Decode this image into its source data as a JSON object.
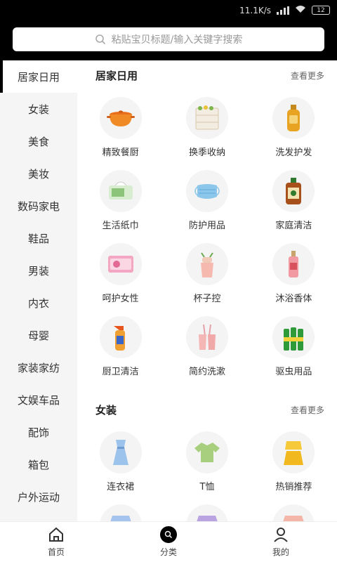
{
  "status": {
    "speed": "11.1K/s",
    "battery": "12"
  },
  "search": {
    "placeholder": "粘贴宝贝标题/输入关键字搜索"
  },
  "sidebar": {
    "items": [
      "居家日用",
      "女装",
      "美食",
      "美妆",
      "数码家电",
      "鞋品",
      "男装",
      "内衣",
      "母婴",
      "家装家纺",
      "文娱车品",
      "配饰",
      "箱包",
      "户外运动"
    ]
  },
  "sections": [
    {
      "title": "居家日用",
      "more": "查看更多",
      "items": [
        {
          "label": "精致餐厨",
          "icon": "pot-icon"
        },
        {
          "label": "换季收纳",
          "icon": "storage-box-icon"
        },
        {
          "label": "洗发护发",
          "icon": "shampoo-bottle-icon"
        },
        {
          "label": "生活纸巾",
          "icon": "tissue-icon"
        },
        {
          "label": "防护用品",
          "icon": "face-mask-icon"
        },
        {
          "label": "家庭清洁",
          "icon": "disinfectant-bottle-icon"
        },
        {
          "label": "呵护女性",
          "icon": "sanitary-pad-icon"
        },
        {
          "label": "杯子控",
          "icon": "cup-icon"
        },
        {
          "label": "沐浴香体",
          "icon": "body-mist-icon"
        },
        {
          "label": "厨卫清洁",
          "icon": "spray-bottle-icon"
        },
        {
          "label": "简约洗漱",
          "icon": "toothbrush-cup-icon"
        },
        {
          "label": "驱虫用品",
          "icon": "repellent-bottles-icon"
        }
      ]
    },
    {
      "title": "女装",
      "more": "查看更多",
      "items": [
        {
          "label": "连衣裙",
          "icon": "dress-icon"
        },
        {
          "label": "T恤",
          "icon": "tshirt-icon"
        },
        {
          "label": "热销推荐",
          "icon": "yellow-outfit-icon"
        }
      ]
    }
  ],
  "tabbar": {
    "tabs": [
      "首页",
      "分类",
      "我的"
    ]
  }
}
